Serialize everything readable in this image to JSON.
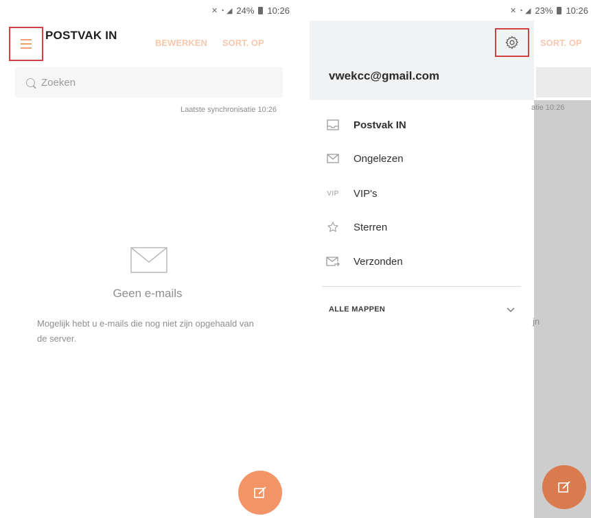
{
  "left": {
    "status": {
      "signal": "📶",
      "battery": "24%",
      "time": "10:26"
    },
    "header": {
      "title": "POSTVAK IN",
      "edit_label": "BEWERKEN",
      "sort_label": "SORT. OP"
    },
    "search": {
      "placeholder": "Zoeken"
    },
    "sync_text": "Laatste synchronisatie 10:26",
    "empty": {
      "title": "Geen e-mails",
      "note": "Mogelijk hebt u e-mails die nog niet zijn opgehaald van de server."
    }
  },
  "right": {
    "status": {
      "battery": "23%",
      "time": "10:26"
    },
    "drawer": {
      "account_email": "vwekcc@gmail.com",
      "items": [
        {
          "label": "Postvak IN",
          "icon": "inbox-icon"
        },
        {
          "label": "Ongelezen",
          "icon": "mail-icon"
        },
        {
          "label": "VIP's",
          "icon": "vip-icon",
          "icon_text": "VIP"
        },
        {
          "label": "Sterren",
          "icon": "star-icon"
        },
        {
          "label": "Verzonden",
          "icon": "sent-icon"
        }
      ],
      "all_folders_label": "ALLE MAPPEN"
    },
    "background": {
      "sort_label": "SORT. OP",
      "sync_fragment": "atie 10:26",
      "note_fragment": "jn"
    }
  },
  "colors": {
    "accent": "#f39466",
    "accent_faded": "#f7c7ae",
    "highlight_box": "#d04040",
    "drawer_header": "#f0f2f3",
    "scrim": "#cdcdcd"
  }
}
